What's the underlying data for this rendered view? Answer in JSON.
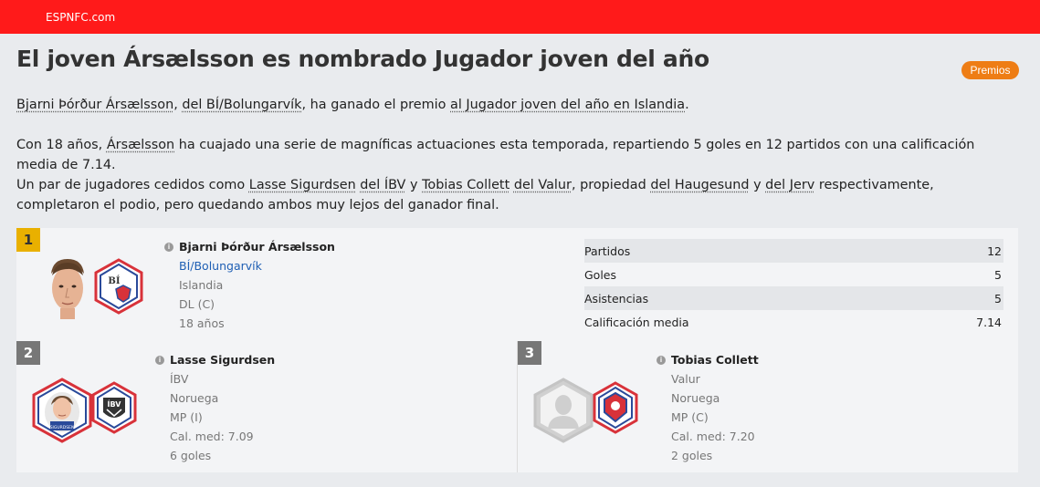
{
  "header": {
    "brand": "ESPNFC.com"
  },
  "article": {
    "title": "El joven Ársælsson es nombrado Jugador joven del año",
    "tag": "Premios",
    "p1": [
      {
        "t": "Bjarni Þórður Ársælsson",
        "link": true
      },
      {
        "t": ", ",
        "link": false
      },
      {
        "t": "del BÍ/Bolungarvík",
        "link": true
      },
      {
        "t": ", ha ganado el premio ",
        "link": false
      },
      {
        "t": "al Jugador joven del año en Islandia",
        "link": true
      },
      {
        "t": ".",
        "link": false
      }
    ],
    "p2": [
      {
        "t": "Con 18 años, ",
        "link": false
      },
      {
        "t": "Ársælsson",
        "link": true
      },
      {
        "t": " ha cuajado una serie de magníficas actuaciones esta temporada, repartiendo 5 goles en 12 partidos con una calificación media de 7.14.",
        "link": false
      }
    ],
    "p3": [
      {
        "t": "Un par de jugadores cedidos como ",
        "link": false
      },
      {
        "t": "Lasse Sigurdsen",
        "link": true
      },
      {
        "t": " ",
        "link": false
      },
      {
        "t": "del ÍBV",
        "link": true
      },
      {
        "t": " y ",
        "link": false
      },
      {
        "t": "Tobias Collett",
        "link": true
      },
      {
        "t": " ",
        "link": false
      },
      {
        "t": "del Valur",
        "link": true
      },
      {
        "t": ", propiedad ",
        "link": false
      },
      {
        "t": "del Haugesund",
        "link": true
      },
      {
        "t": " y ",
        "link": false
      },
      {
        "t": "del Jerv",
        "link": true
      },
      {
        "t": " respectivamente, completaron el podio, pero quedando ambos muy lejos del ganador final.",
        "link": false
      }
    ]
  },
  "winner": {
    "rank": "1",
    "name": "Bjarni Þórður Ársælsson",
    "club": "BÍ/Bolungarvík",
    "nation": "Islandia",
    "position": "DL (C)",
    "age": "18 años",
    "stats": [
      {
        "label": "Partidos",
        "value": "12"
      },
      {
        "label": "Goles",
        "value": "5"
      },
      {
        "label": "Asistencias",
        "value": "5"
      },
      {
        "label": "Calificación media",
        "value": "7.14"
      }
    ]
  },
  "second": {
    "rank": "2",
    "name": "Lasse Sigurdsen",
    "club": "ÍBV",
    "nation": "Noruega",
    "position": "MP (I)",
    "rating": "Cal. med: 7.09",
    "goals": "6 goles",
    "badge_text": "ÍBV",
    "photo_caption": "SIGURDSEN"
  },
  "third": {
    "rank": "3",
    "name": "Tobias Collett",
    "club": "Valur",
    "nation": "Noruega",
    "position": "MP (C)",
    "rating": "Cal. med: 7.20",
    "goals": "2 goles"
  },
  "badges": {
    "bi": "BÍ"
  },
  "colors": {
    "topbar": "#ff1a1a",
    "tag": "#ee7d15",
    "rank1": "#e9b000",
    "rank_other": "#777777",
    "club_link": "#1f5fb4"
  }
}
